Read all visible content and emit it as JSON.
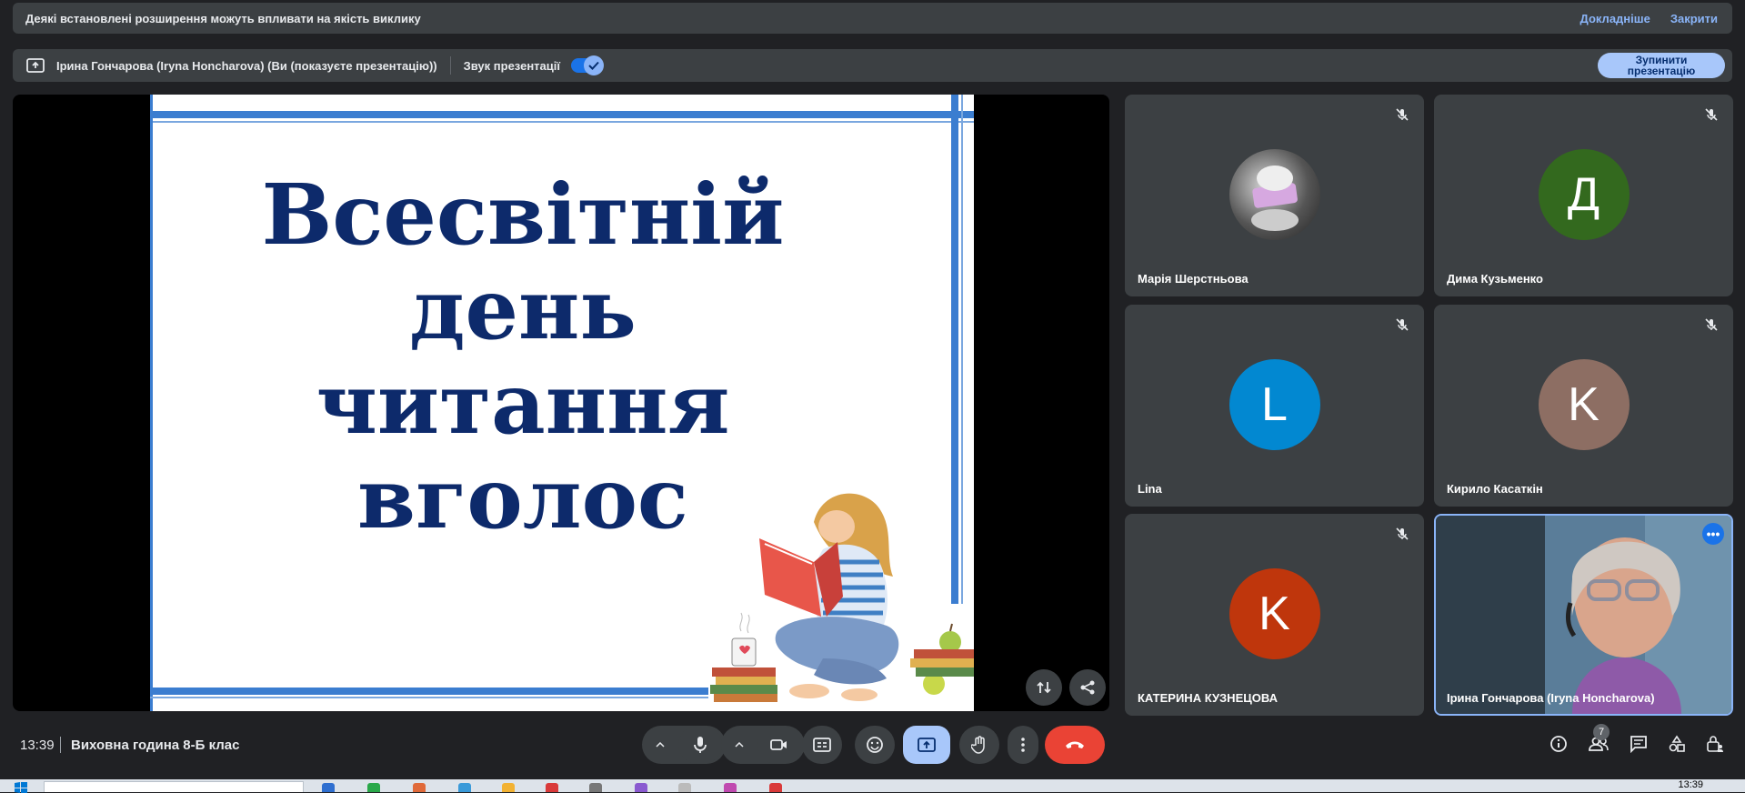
{
  "notice": {
    "message": "Деякі встановлені розширення можуть впливати на якість виклику",
    "more_link": "Докладніше",
    "close_link": "Закрити"
  },
  "presenting": {
    "presenter_text": "Ірина Гончарова (Iryna Honcharova) (Ви (показуєте презентацію))",
    "sound_label": "Звук презентації",
    "sound_on": true,
    "stop_button": "Зупинити презентацію"
  },
  "slide": {
    "title_lines": [
      "Всесвітній",
      "день",
      "читання",
      "вголос"
    ]
  },
  "participants": [
    {
      "name": "Марія Шерстньова",
      "initial": "",
      "avatar_color": "#5a5a5a",
      "muted": true,
      "has_photo": true
    },
    {
      "name": "Дима Кузьменко",
      "initial": "Д",
      "avatar_color": "#33691e",
      "muted": true
    },
    {
      "name": "Lina",
      "initial": "L",
      "avatar_color": "#0288d1",
      "muted": true
    },
    {
      "name": "Кирило Касаткін",
      "initial": "K",
      "avatar_color": "#8d6e63",
      "muted": true
    },
    {
      "name": "КАТЕРИНА КУЗНЕЦОВА",
      "initial": "K",
      "avatar_color": "#bf360c",
      "muted": true
    },
    {
      "name": "Ірина Гончарова (Iryna Honcharova)",
      "initial": "",
      "avatar_color": "#4a6a8a",
      "muted": false,
      "self_video": true
    }
  ],
  "controls": {
    "time": "13:39",
    "meeting_title": "Виховна година 8-Б клас",
    "people_count": "7"
  },
  "taskbar": {
    "clock": "13:39"
  }
}
